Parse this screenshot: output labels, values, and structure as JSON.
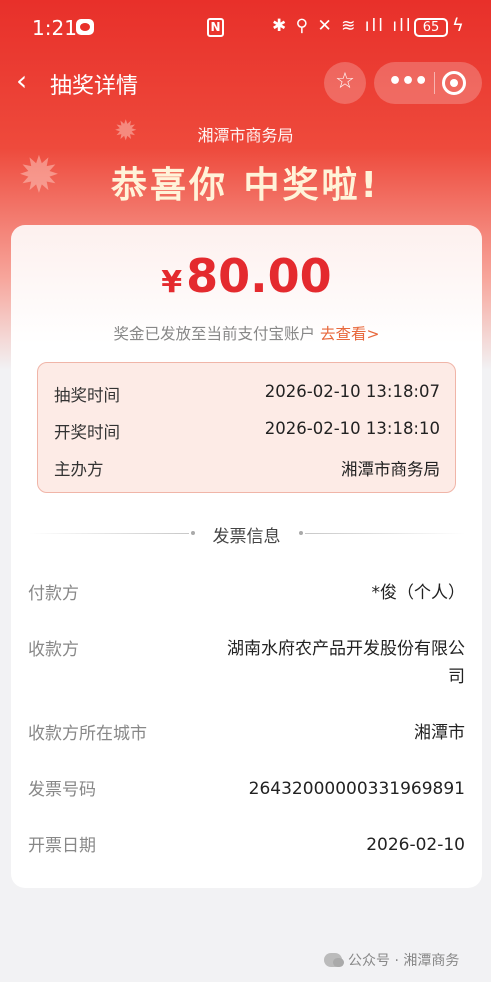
{
  "status_bar": {
    "time": "1:21",
    "system_icons": "✱ ⚲ ✕ ≋ ıll ıll",
    "battery": "65",
    "charging": "ϟ"
  },
  "nav": {
    "back_icon": "chevron-left",
    "title": "抽奖详情",
    "favorite_icon": "☆",
    "more_icon": "•••"
  },
  "hero": {
    "organizer": "湘潭市商务局",
    "headline": "恭喜你 中奖啦!"
  },
  "prize": {
    "currency": "¥",
    "amount": "80.00",
    "note": "奖金已发放至当前支付宝账户",
    "link_label": "去查看>"
  },
  "draw_info": [
    {
      "label": "抽奖时间",
      "value": "2026-02-10 13:18:07"
    },
    {
      "label": "开奖时间",
      "value": "2026-02-10 13:18:10"
    },
    {
      "label": "主办方",
      "value": "湘潭市商务局"
    }
  ],
  "invoice": {
    "section_title": "发票信息",
    "rows": [
      {
        "label": "付款方",
        "value": "*俊（个人）"
      },
      {
        "label": "收款方",
        "value": "湖南水府农产品开发股份有限公",
        "value_line2": "司"
      },
      {
        "label": "收款方所在城市",
        "value": "湘潭市"
      },
      {
        "label": "发票号码",
        "value": "26432000000331969891"
      },
      {
        "label": "开票日期",
        "value": "2026-02-10"
      }
    ]
  },
  "footer": {
    "watermark": "公众号 · 湘潭商务"
  },
  "colors": {
    "brand_red": "#e8302a",
    "amount_red": "#e42a2e",
    "link_orange": "#e8683c",
    "info_box_bg": "#fdebe6"
  }
}
